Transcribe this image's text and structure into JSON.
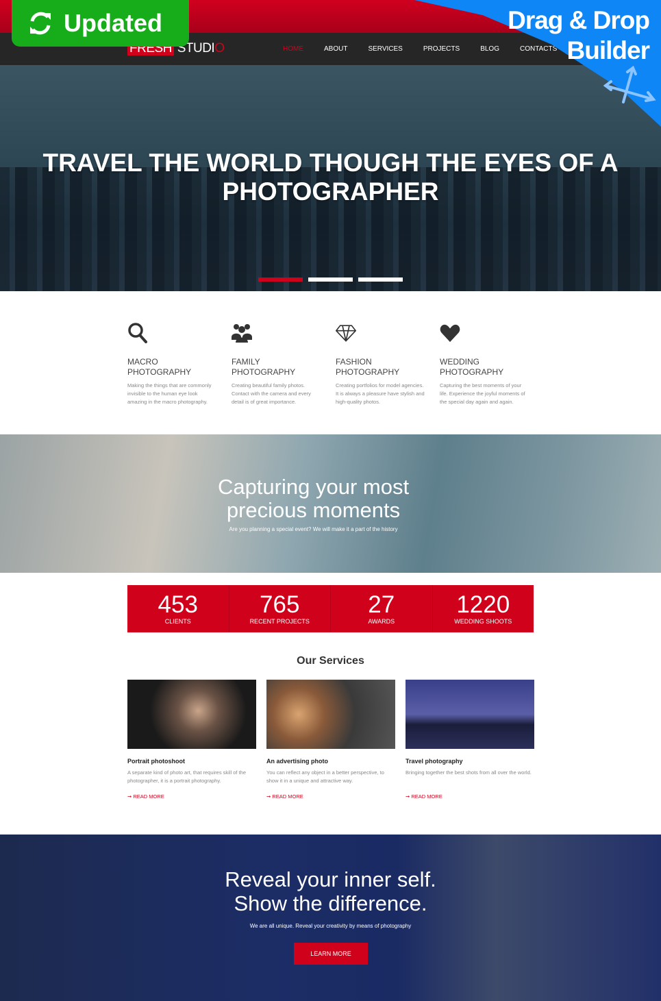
{
  "badges": {
    "updated": "Updated",
    "builder": "Drag & Drop Builder",
    "updated_icon": "refresh-icon",
    "builder_icon": "move-arrows-icon"
  },
  "logo": {
    "part1": "FRESH",
    "part2": "STUDI",
    "part3": "O"
  },
  "nav": [
    {
      "label": "HOME",
      "active": true
    },
    {
      "label": "ABOUT"
    },
    {
      "label": "SERVICES"
    },
    {
      "label": "PROJECTS"
    },
    {
      "label": "BLOG"
    },
    {
      "label": "CONTACTS"
    }
  ],
  "hero": {
    "title": "TRAVEL THE WORLD THOUGH THE EYES OF A PHOTOGRAPHER",
    "slides": 3,
    "active_slide": 1
  },
  "features": [
    {
      "icon": "search-icon",
      "title1": "MACRO",
      "title2": "PHOTOGRAPHY",
      "text": "Making the things that are commonly invisible to the human eye look amazing in the macro photography."
    },
    {
      "icon": "users-icon",
      "title1": "FAMILY",
      "title2": "PHOTOGRAPHY",
      "text": "Creating beautiful family photos. Contact with the camera and every detail is of great importance."
    },
    {
      "icon": "diamond-icon",
      "title1": "FASHION",
      "title2": "PHOTOGRAPHY",
      "text": "Creating portfolios for model agencies. It is always a pleasure have stylish and high-quality photos."
    },
    {
      "icon": "heart-icon",
      "title1": "WEDDING",
      "title2": "PHOTOGRAPHY",
      "text": "Capturing the best moments of your life. Experience the joyful moments of the special day again and again."
    }
  ],
  "band": {
    "title": "Capturing your most precious moments",
    "subtitle": "Are you planning a special event? We will make it a part of the history"
  },
  "stats": [
    {
      "n": "453",
      "l": "CLIENTS"
    },
    {
      "n": "765",
      "l": "RECENT PROJECTS"
    },
    {
      "n": "27",
      "l": "AWARDS"
    },
    {
      "n": "1220",
      "l": "WEDDING SHOOTS"
    }
  ],
  "services": {
    "heading": "Our Services",
    "items": [
      {
        "title": "Portrait photoshoot",
        "text": "A separate kind of photo art, that requires skill of the photographer, it is a portrait photography.",
        "link": "READ MORE"
      },
      {
        "title": "An advertising photo",
        "text": "You can reflect any object in a better perspective, to show it in a unique and attractive way.",
        "link": "READ MORE"
      },
      {
        "title": "Travel photography",
        "text": "Bringing together the best shots from all over the world.",
        "link": "READ MORE"
      }
    ]
  },
  "cta": {
    "line1": "Reveal your inner self.",
    "line2": "Show  the difference.",
    "text": "We are all unique. Reveal your creativity by means of photography",
    "button": "LEARN MORE"
  },
  "colors": {
    "accent": "#d0021b",
    "nav": "#262626",
    "badge_green": "#17ad1a",
    "badge_blue": "#0e86f5"
  }
}
